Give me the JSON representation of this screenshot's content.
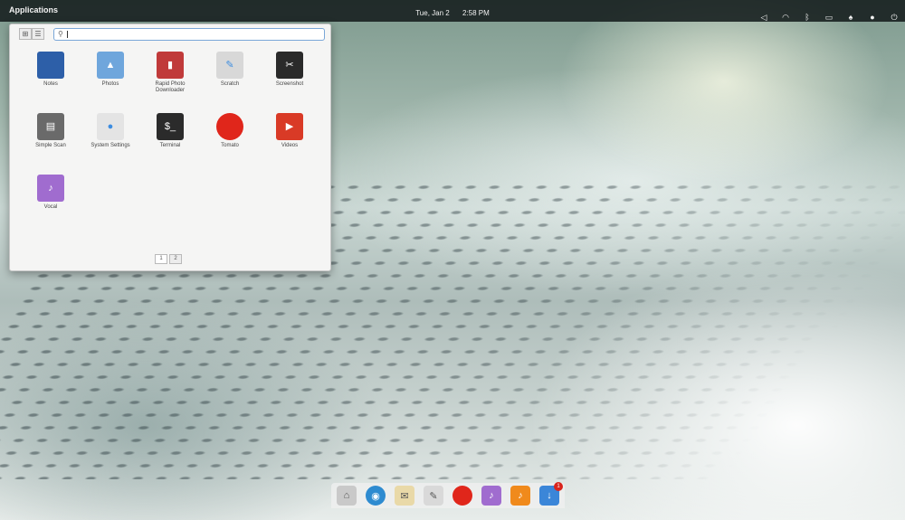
{
  "panel": {
    "applications_label": "Applications",
    "date": "Tue, Jan 2",
    "time": "2:58 PM"
  },
  "indicators": [
    {
      "icon": "volume-icon",
      "glyph": "◁"
    },
    {
      "icon": "network-icon",
      "glyph": "◠"
    },
    {
      "icon": "bluetooth-icon",
      "glyph": "ᛒ"
    },
    {
      "icon": "battery-icon",
      "glyph": "▭"
    },
    {
      "icon": "notifications-icon",
      "glyph": "♠"
    },
    {
      "icon": "user-icon",
      "glyph": "●"
    },
    {
      "icon": "power-icon",
      "glyph": "⏻"
    }
  ],
  "launcher": {
    "view_toggle": [
      "⊞",
      "☰"
    ],
    "search": {
      "value": "",
      "icon_glyph": "⚲"
    },
    "apps": [
      {
        "label": "Notes",
        "icon": "notes-icon",
        "glyph": "",
        "color": "#2d5fa8"
      },
      {
        "label": "Photos",
        "icon": "photos-icon",
        "glyph": "▲",
        "color": "#6fa6dc"
      },
      {
        "label": "Rapid Photo Downloader",
        "icon": "rapid-photo-downloader-icon",
        "glyph": "▮",
        "color": "#c03a3a"
      },
      {
        "label": "Scratch",
        "icon": "scratch-icon",
        "glyph": "✎",
        "color": "#d8d8d8"
      },
      {
        "label": "Screenshot",
        "icon": "screenshot-icon",
        "glyph": "✂",
        "color": "#2a2a2a"
      },
      {
        "label": "Simple Scan",
        "icon": "simple-scan-icon",
        "glyph": "▤",
        "color": "#6a6a6a"
      },
      {
        "label": "System Settings",
        "icon": "system-settings-icon",
        "glyph": "●",
        "color": "#e4e4e4"
      },
      {
        "label": "Terminal",
        "icon": "terminal-icon",
        "glyph": "$_",
        "color": "#2b2b2b"
      },
      {
        "label": "Tomato",
        "icon": "tomato-icon",
        "glyph": "",
        "color": "#e0261b"
      },
      {
        "label": "Videos",
        "icon": "videos-icon",
        "glyph": "▶",
        "color": "#d93a26"
      },
      {
        "label": "Vocal",
        "icon": "vocal-icon",
        "glyph": "♪",
        "color": "#a06ccf"
      }
    ],
    "pages": [
      "1",
      "2"
    ]
  },
  "dock": [
    {
      "icon": "files-icon",
      "glyph": "⌂",
      "color": "#c9c9c9",
      "badge": ""
    },
    {
      "icon": "browser-icon",
      "glyph": "◉",
      "color": "#2e8bd0",
      "badge": ""
    },
    {
      "icon": "mail-icon",
      "glyph": "✉",
      "color": "#e9d9a8",
      "badge": ""
    },
    {
      "icon": "scratch-dock-icon",
      "glyph": "✎",
      "color": "#d9d9d9",
      "badge": ""
    },
    {
      "icon": "tomato-dock-icon",
      "glyph": "",
      "color": "#e0261b",
      "badge": ""
    },
    {
      "icon": "vocal-dock-icon",
      "glyph": "♪",
      "color": "#a06ccf",
      "badge": ""
    },
    {
      "icon": "music-icon",
      "glyph": "♪",
      "color": "#f08a1c",
      "badge": ""
    },
    {
      "icon": "appcenter-icon",
      "glyph": "↓",
      "color": "#3b86d8",
      "badge": "1"
    }
  ]
}
